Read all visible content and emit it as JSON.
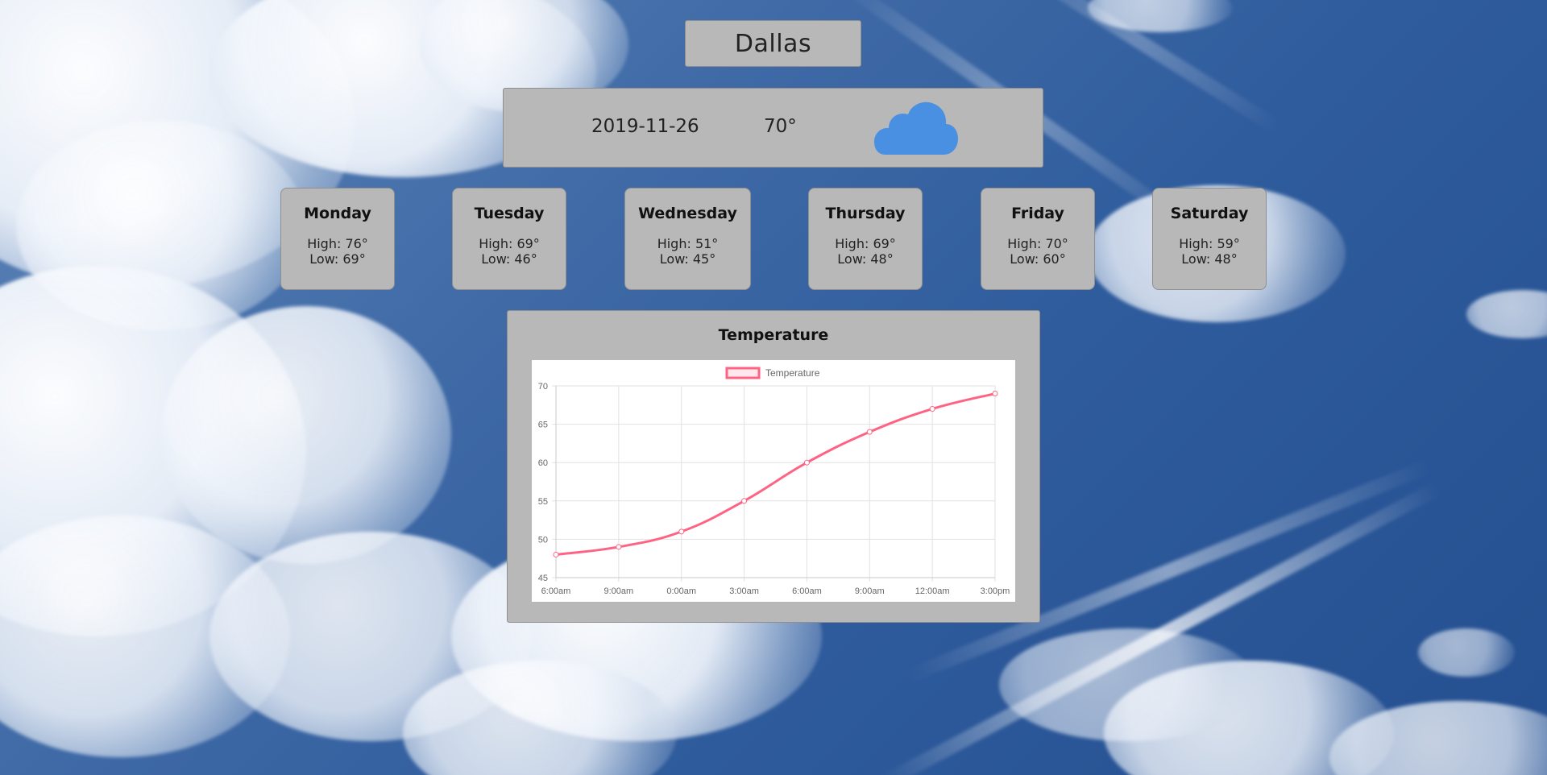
{
  "city": {
    "name": "Dallas"
  },
  "current": {
    "date": "2019-11-26",
    "temperature": "70°",
    "icon": "cloud-icon",
    "icon_color": "#4a90e2"
  },
  "forecast": [
    {
      "day": "Monday",
      "high": "High: 76°",
      "low": "Low: 69°"
    },
    {
      "day": "Tuesday",
      "high": "High: 69°",
      "low": "Low: 46°"
    },
    {
      "day": "Wednesday",
      "high": "High: 51°",
      "low": "Low: 45°"
    },
    {
      "day": "Thursday",
      "high": "High: 69°",
      "low": "Low: 48°"
    },
    {
      "day": "Friday",
      "high": "High: 70°",
      "low": "Low: 60°"
    },
    {
      "day": "Saturday",
      "high": "High: 59°",
      "low": "Low: 48°"
    }
  ],
  "chart_panel": {
    "title": "Temperature"
  },
  "chart_data": {
    "type": "line",
    "title": "",
    "xlabel": "",
    "ylabel": "",
    "categories": [
      "6:00am",
      "9:00am",
      "0:00am",
      "3:00am",
      "6:00am",
      "9:00am",
      "12:00am",
      "3:00pm"
    ],
    "series": [
      {
        "name": "Temperature",
        "values": [
          48,
          49,
          51,
          55,
          60,
          64,
          67,
          69
        ],
        "color": "#ff6384"
      }
    ],
    "ylim": [
      45,
      70
    ],
    "yticks": [
      45,
      50,
      55,
      60,
      65,
      70
    ],
    "grid": true,
    "legend": "top-center"
  }
}
